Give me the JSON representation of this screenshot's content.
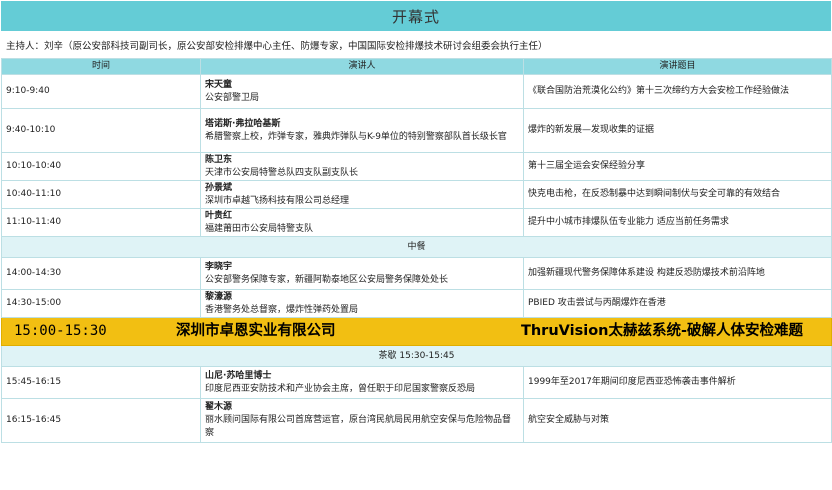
{
  "title": "开幕式",
  "host": "主持人：刘辛（原公安部科技司副司长，原公安部安检排爆中心主任、防爆专家，中国国际安检排爆技术研讨会组委会执行主任）",
  "columns": {
    "time": "时间",
    "speaker": "演讲人",
    "topic": "演讲题目"
  },
  "rows_a": [
    {
      "time": "9:10-9:40",
      "name": "宋天童",
      "org": "公安部警卫局",
      "topic": "《联合国防治荒漠化公约》第十三次缔约方大会安检工作经验做法"
    },
    {
      "time": "9:40-10:10",
      "name": "塔诺斯·弗拉哈基斯",
      "org": "希腊警察上校，炸弹专家，雅典炸弹队与K-9单位的特别警察部队首长级长官",
      "topic": "爆炸的新发展—发现收集的证据"
    },
    {
      "time": "10:10-10:40",
      "name": "陈卫东",
      "org": "天津市公安局特警总队四支队副支队长",
      "topic": "第十三届全运会安保经验分享"
    },
    {
      "time": "10:40-11:10",
      "name": "孙景斌",
      "org": "深圳市卓越飞扬科技有限公司总经理",
      "topic": "快克电击枪，在反恐制暴中达到瞬间制伏与安全可靠的有效结合"
    },
    {
      "time": "11:10-11:40",
      "name": "叶贵红",
      "org": "福建莆田市公安局特警支队",
      "topic": "提升中小城市排爆队伍专业能力 适应当前任务需求"
    }
  ],
  "lunch": "中餐",
  "rows_b": [
    {
      "time": "14:00-14:30",
      "name": "李晓宇",
      "org": "公安部警务保障专家，新疆阿勒泰地区公安局警务保障处处长",
      "topic": "加强新疆现代警务保障体系建设 构建反恐防爆技术前沿阵地"
    },
    {
      "time": "14:30-15:00",
      "name": "黎濠源",
      "org": "香港警务处总督察，爆炸性弹药处置局",
      "topic": "PBIED 攻击尝试与丙酮爆炸在香港"
    }
  ],
  "sponsor": {
    "time": "15:00-15:30",
    "company": "深圳市卓恩实业有限公司",
    "topic": "ThruVision太赫兹系统-破解人体安检难题"
  },
  "tea": "茶歇 15:30-15:45",
  "rows_c": [
    {
      "time": "15:45-16:15",
      "name": "山尼·苏哈里博士",
      "org": "印度尼西亚安防技术和产业协会主席，曾任职于印尼国家警察反恐局",
      "topic": "1999年至2017年期间印度尼西亚恐怖袭击事件解析"
    },
    {
      "time": "16:15-16:45",
      "name": "翟木源",
      "org": "丽水顾问国际有限公司首席营运官，原台湾民航局民用航空安保与危险物品督察",
      "topic": "航空安全威胁与对策"
    }
  ],
  "colors": {
    "title_bg": "#64ccd6",
    "header_bg": "#8fd9e1",
    "sponsor_bg": "#f2bf12",
    "break_bg": "#dff3f6"
  }
}
